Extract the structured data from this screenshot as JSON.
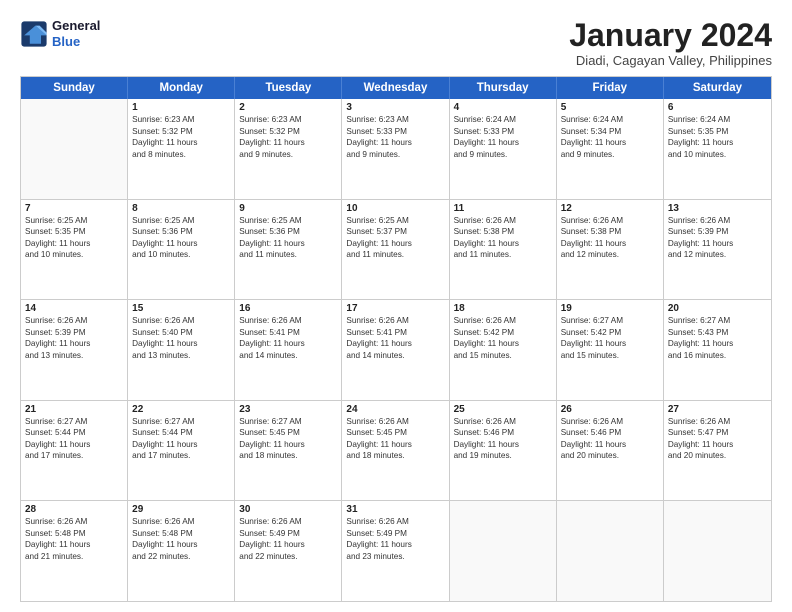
{
  "logo": {
    "line1": "General",
    "line2": "Blue"
  },
  "title": {
    "month": "January 2024",
    "location": "Diadi, Cagayan Valley, Philippines"
  },
  "header_days": [
    "Sunday",
    "Monday",
    "Tuesday",
    "Wednesday",
    "Thursday",
    "Friday",
    "Saturday"
  ],
  "weeks": [
    [
      {
        "day": "",
        "info": ""
      },
      {
        "day": "1",
        "info": "Sunrise: 6:23 AM\nSunset: 5:32 PM\nDaylight: 11 hours\nand 8 minutes."
      },
      {
        "day": "2",
        "info": "Sunrise: 6:23 AM\nSunset: 5:32 PM\nDaylight: 11 hours\nand 9 minutes."
      },
      {
        "day": "3",
        "info": "Sunrise: 6:23 AM\nSunset: 5:33 PM\nDaylight: 11 hours\nand 9 minutes."
      },
      {
        "day": "4",
        "info": "Sunrise: 6:24 AM\nSunset: 5:33 PM\nDaylight: 11 hours\nand 9 minutes."
      },
      {
        "day": "5",
        "info": "Sunrise: 6:24 AM\nSunset: 5:34 PM\nDaylight: 11 hours\nand 9 minutes."
      },
      {
        "day": "6",
        "info": "Sunrise: 6:24 AM\nSunset: 5:35 PM\nDaylight: 11 hours\nand 10 minutes."
      }
    ],
    [
      {
        "day": "7",
        "info": "Sunrise: 6:25 AM\nSunset: 5:35 PM\nDaylight: 11 hours\nand 10 minutes."
      },
      {
        "day": "8",
        "info": "Sunrise: 6:25 AM\nSunset: 5:36 PM\nDaylight: 11 hours\nand 10 minutes."
      },
      {
        "day": "9",
        "info": "Sunrise: 6:25 AM\nSunset: 5:36 PM\nDaylight: 11 hours\nand 11 minutes."
      },
      {
        "day": "10",
        "info": "Sunrise: 6:25 AM\nSunset: 5:37 PM\nDaylight: 11 hours\nand 11 minutes."
      },
      {
        "day": "11",
        "info": "Sunrise: 6:26 AM\nSunset: 5:38 PM\nDaylight: 11 hours\nand 11 minutes."
      },
      {
        "day": "12",
        "info": "Sunrise: 6:26 AM\nSunset: 5:38 PM\nDaylight: 11 hours\nand 12 minutes."
      },
      {
        "day": "13",
        "info": "Sunrise: 6:26 AM\nSunset: 5:39 PM\nDaylight: 11 hours\nand 12 minutes."
      }
    ],
    [
      {
        "day": "14",
        "info": "Sunrise: 6:26 AM\nSunset: 5:39 PM\nDaylight: 11 hours\nand 13 minutes."
      },
      {
        "day": "15",
        "info": "Sunrise: 6:26 AM\nSunset: 5:40 PM\nDaylight: 11 hours\nand 13 minutes."
      },
      {
        "day": "16",
        "info": "Sunrise: 6:26 AM\nSunset: 5:41 PM\nDaylight: 11 hours\nand 14 minutes."
      },
      {
        "day": "17",
        "info": "Sunrise: 6:26 AM\nSunset: 5:41 PM\nDaylight: 11 hours\nand 14 minutes."
      },
      {
        "day": "18",
        "info": "Sunrise: 6:26 AM\nSunset: 5:42 PM\nDaylight: 11 hours\nand 15 minutes."
      },
      {
        "day": "19",
        "info": "Sunrise: 6:27 AM\nSunset: 5:42 PM\nDaylight: 11 hours\nand 15 minutes."
      },
      {
        "day": "20",
        "info": "Sunrise: 6:27 AM\nSunset: 5:43 PM\nDaylight: 11 hours\nand 16 minutes."
      }
    ],
    [
      {
        "day": "21",
        "info": "Sunrise: 6:27 AM\nSunset: 5:44 PM\nDaylight: 11 hours\nand 17 minutes."
      },
      {
        "day": "22",
        "info": "Sunrise: 6:27 AM\nSunset: 5:44 PM\nDaylight: 11 hours\nand 17 minutes."
      },
      {
        "day": "23",
        "info": "Sunrise: 6:27 AM\nSunset: 5:45 PM\nDaylight: 11 hours\nand 18 minutes."
      },
      {
        "day": "24",
        "info": "Sunrise: 6:26 AM\nSunset: 5:45 PM\nDaylight: 11 hours\nand 18 minutes."
      },
      {
        "day": "25",
        "info": "Sunrise: 6:26 AM\nSunset: 5:46 PM\nDaylight: 11 hours\nand 19 minutes."
      },
      {
        "day": "26",
        "info": "Sunrise: 6:26 AM\nSunset: 5:46 PM\nDaylight: 11 hours\nand 20 minutes."
      },
      {
        "day": "27",
        "info": "Sunrise: 6:26 AM\nSunset: 5:47 PM\nDaylight: 11 hours\nand 20 minutes."
      }
    ],
    [
      {
        "day": "28",
        "info": "Sunrise: 6:26 AM\nSunset: 5:48 PM\nDaylight: 11 hours\nand 21 minutes."
      },
      {
        "day": "29",
        "info": "Sunrise: 6:26 AM\nSunset: 5:48 PM\nDaylight: 11 hours\nand 22 minutes."
      },
      {
        "day": "30",
        "info": "Sunrise: 6:26 AM\nSunset: 5:49 PM\nDaylight: 11 hours\nand 22 minutes."
      },
      {
        "day": "31",
        "info": "Sunrise: 6:26 AM\nSunset: 5:49 PM\nDaylight: 11 hours\nand 23 minutes."
      },
      {
        "day": "",
        "info": ""
      },
      {
        "day": "",
        "info": ""
      },
      {
        "day": "",
        "info": ""
      }
    ]
  ]
}
